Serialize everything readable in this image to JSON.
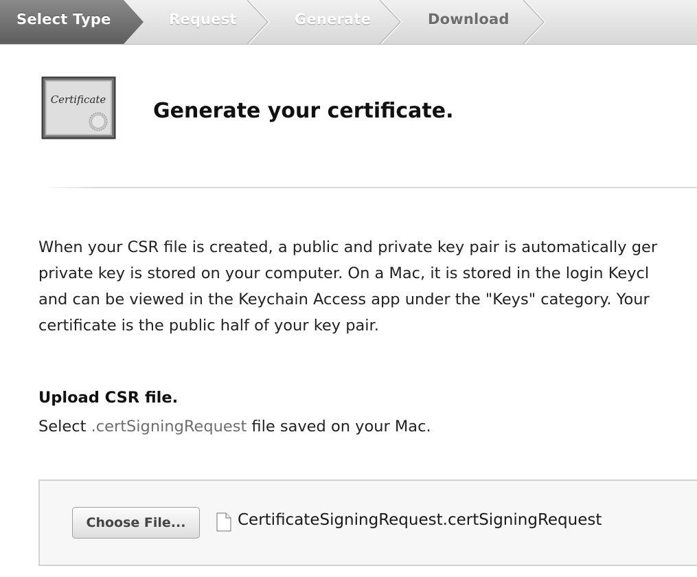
{
  "steps": [
    {
      "label": "Select Type",
      "state": "active"
    },
    {
      "label": "Request",
      "state": "future"
    },
    {
      "label": "Generate",
      "state": "future"
    },
    {
      "label": "Download",
      "state": "future"
    }
  ],
  "header": {
    "icon_text": "Certificate",
    "icon": "certificate-icon",
    "title": "Generate your certificate."
  },
  "description": {
    "lines": [
      "When your CSR file is created, a public and private key pair is automatically ger",
      "private key is stored on your computer. On a Mac, it is stored in the login Keycl",
      "and can be viewed in the Keychain Access app under the \"Keys\" category. Your",
      "certificate is the public half of your key pair."
    ]
  },
  "upload": {
    "heading": "Upload CSR file.",
    "instruction_prefix": "Select ",
    "instruction_ext": ".certSigningRequest",
    "instruction_suffix": " file saved on your Mac.",
    "button_label": "Choose File...",
    "file_icon": "document-icon",
    "file_name": "CertificateSigningRequest.certSigningRequest"
  }
}
